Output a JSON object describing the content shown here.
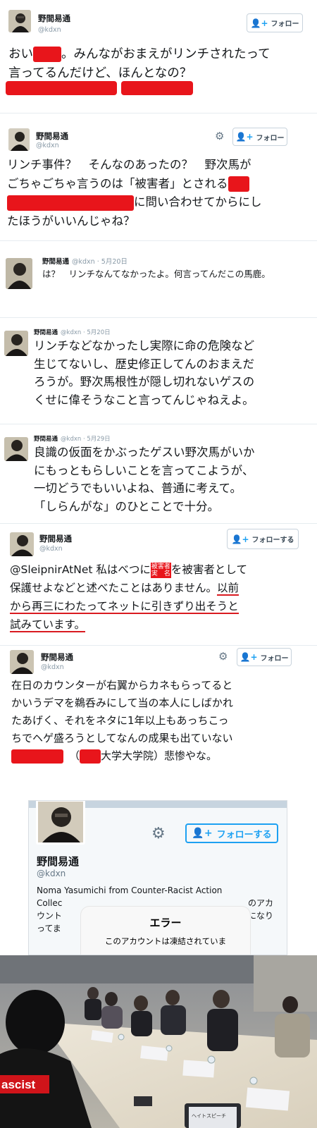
{
  "author": {
    "name": "野間易通",
    "handle": "@kdxn"
  },
  "buttons": {
    "follow": "フォロー",
    "follow_su": "フォローする"
  },
  "tweets": [
    {
      "l1_a": "おい",
      "l1_b": "。みんながおまえがリンチされたって",
      "l2": "言ってるんだけど、ほんとなの？"
    },
    {
      "l1": "リンチ事件？　そんなのあったの？　野次馬が",
      "l2_a": "ごちゃごちゃ言うのは「被害者」とされる",
      "l3_b": "に問い合わせてからにし",
      "l4": "たほうがいいんじゃね？"
    },
    {
      "date": "· 5月20日",
      "text": "は？　リンチなんてなかったよ。何言ってんだこの馬鹿。"
    },
    {
      "date": "· 5月20日",
      "lines": [
        "リンチなどなかったし実際に命の危険など",
        "生じてないし、歴史修正してんのおまえだ",
        "ろうが。野次馬根性が隠し切れないゲスの",
        "くせに偉そうなこと言ってんじゃねえよ。"
      ]
    },
    {
      "date": "· 5月29日",
      "lines": [
        "良識の仮面をかぶったゲスい野次馬がいか",
        "にもっともらしいことを言ってこようが、",
        "一切どうでもいいよね、普通に考えて。",
        "「しらんがな」のひとことで十分。"
      ]
    },
    {
      "mention": "@SleipnirAtNet",
      "l1_a": "私はべつに",
      "tag_top": "被害者",
      "tag_bottom": "実　名",
      "l1_b": "を被害者として",
      "l2_a": "保護せよなどと述べたことはありません。",
      "l2_b": "以前",
      "l3": "から再三にわたってネットに引きずり出そうと",
      "l4": "試みています。"
    },
    {
      "lines": [
        "在日のカウンターが右翼からカネもらってると",
        "かいうデマを鵜呑みにして当の本人にしばかれ",
        "たあげく、それをネタに1年以上もあっちこっ",
        "ちでヘゲ盛ろうとしてなんの成果も出ていない"
      ],
      "l5_a": "（",
      "l5_b": "大学大学院）悲惨やな。"
    }
  ],
  "profile": {
    "name": "野間易通",
    "handle": "@kdxn",
    "bio_1": "Noma Yasumichi from Counter-Racist Action",
    "bio_2": "Collec",
    "bio_2_right": "のアカ",
    "bio_3": "ウント",
    "bio_3_right": "になり",
    "bio_4": "ってま",
    "error_title": "エラー",
    "error_body": "このアカウントは凍結されていま"
  },
  "photo": {
    "sign": "ヘイトスピーチ",
    "shirt": "ascist"
  }
}
